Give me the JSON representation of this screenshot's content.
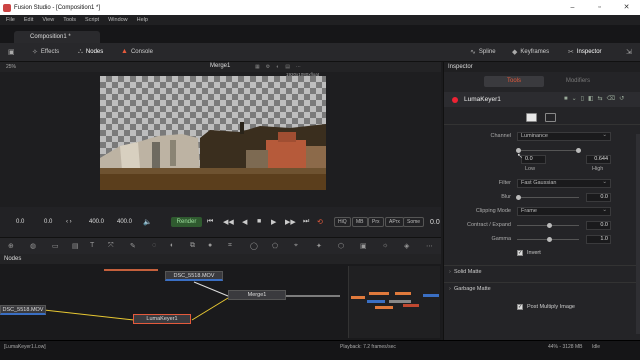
{
  "window": {
    "title": "Fusion Studio - [Composition1 *]"
  },
  "menu": [
    "File",
    "Edit",
    "View",
    "Tools",
    "Script",
    "Window",
    "Help"
  ],
  "tab": {
    "label": "Composition1 *"
  },
  "toolbar": {
    "effects": "Effects",
    "nodes": "Nodes",
    "console": "Console",
    "spline": "Spline",
    "keyframes": "Keyframes",
    "inspector": "Inspector"
  },
  "viewer": {
    "zoom": "25%",
    "name": "Merge1",
    "resolution": "1920x1080xfloat"
  },
  "transport": {
    "start": "0.0",
    "current": "0.0",
    "end": "400.0",
    "end2": "400.0",
    "render": "Render",
    "hiq": "HiQ",
    "mb": "MB",
    "prx": "Prx",
    "aprx": "APrx",
    "some": "Some",
    "frame": "0.0"
  },
  "nodes": {
    "header": "Nodes",
    "items": [
      "DSC_5518.MOV",
      "DSC_5518.MOV",
      "Merge1",
      "LumaKeyer1"
    ]
  },
  "status": {
    "left": "[LumaKeyer1.Low]",
    "playback": "Playback: 7.2 frames/sec",
    "memory": "44% - 3128 MB",
    "state": "Idle"
  },
  "inspector": {
    "header": "Inspector",
    "tab_tools": "Tools",
    "tab_modifiers": "Modifiers",
    "node_name": "LumaKeyer1",
    "channel_label": "Channel",
    "channel_value": "Luminance",
    "low_value": "0.0",
    "high_value": "0.644",
    "low_label": "Low",
    "high_label": "High",
    "filter_label": "Filter",
    "filter_value": "Fast Gaussian",
    "blur_label": "Blur",
    "blur_value": "0.0",
    "clipping_label": "Clipping Mode",
    "clipping_value": "Frame",
    "contract_label": "Contract / Expand",
    "contract_value": "0.0",
    "gamma_label": "Gamma",
    "gamma_value": "1.0",
    "invert_label": "Invert",
    "solid_matte": "Solid Matte",
    "garbage_matte": "Garbage Matte",
    "post_multiply": "Post Multiply Image"
  },
  "colors": {
    "accent": "#e45a3c",
    "selected_node": "#e45a3c",
    "media_in": "#3a6fc4"
  }
}
